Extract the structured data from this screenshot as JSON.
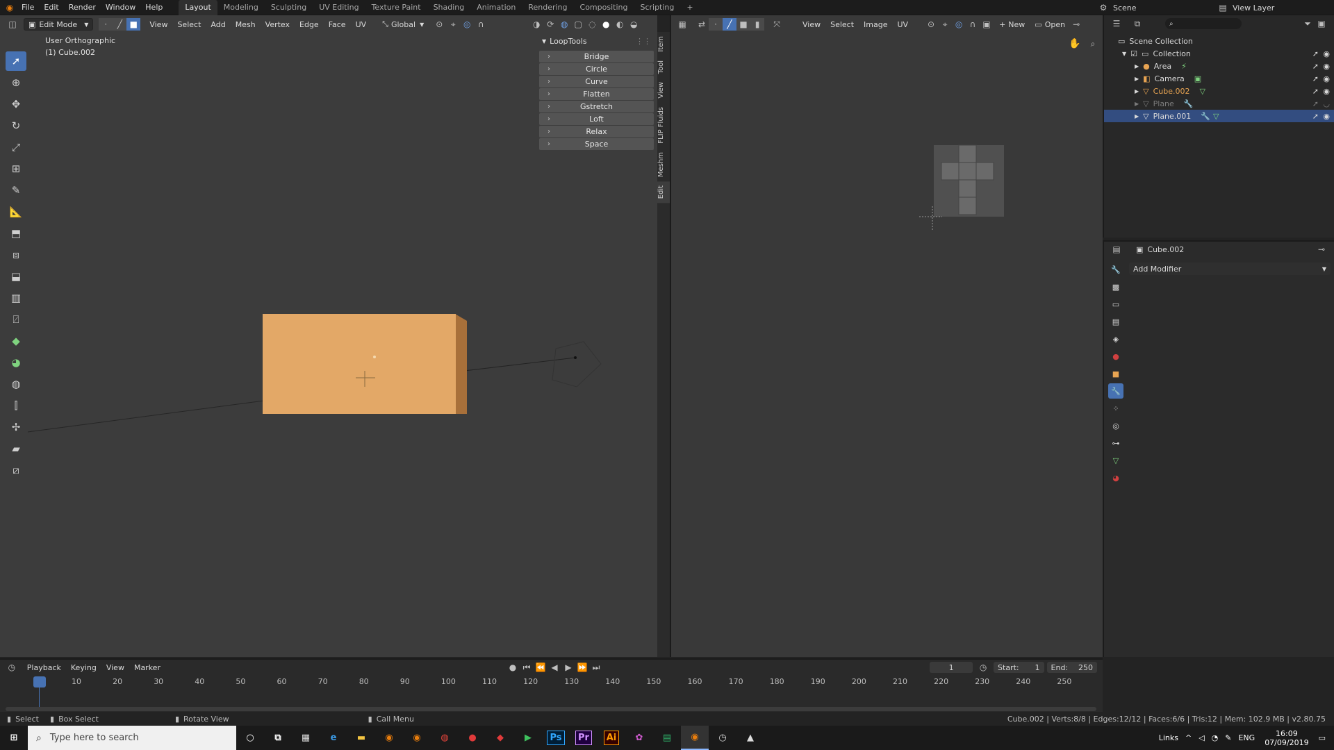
{
  "topbar": {
    "menus": [
      "File",
      "Edit",
      "Render",
      "Window",
      "Help"
    ],
    "workspaces": [
      "Layout",
      "Modeling",
      "Sculpting",
      "UV Editing",
      "Texture Paint",
      "Shading",
      "Animation",
      "Rendering",
      "Compositing",
      "Scripting"
    ],
    "active_workspace": "Layout",
    "scene_label": "Scene",
    "view_layer_label": "View Layer"
  },
  "viewport": {
    "mode": "Edit Mode",
    "menus": [
      "View",
      "Select",
      "Add",
      "Mesh",
      "Vertex",
      "Edge",
      "Face",
      "UV"
    ],
    "transform_orientation": "Global",
    "view_name": "User Orthographic",
    "object_name": "(1) Cube.002"
  },
  "looptools": {
    "title": "LoopTools",
    "items": [
      "Bridge",
      "Circle",
      "Curve",
      "Flatten",
      "Gstretch",
      "Loft",
      "Relax",
      "Space"
    ]
  },
  "sidebar_tabs": [
    "Item",
    "Tool",
    "View",
    "FLIP Fluids",
    "Meshm",
    "Edit"
  ],
  "uv_editor": {
    "menus": [
      "View",
      "Select",
      "Image",
      "UV"
    ],
    "new_label": "New",
    "open_label": "Open"
  },
  "outliner": {
    "root": "Scene Collection",
    "collection": "Collection",
    "items": [
      {
        "name": "Area",
        "color": "#d8d8d8"
      },
      {
        "name": "Camera",
        "color": "#d8d8d8"
      },
      {
        "name": "Cube.002",
        "color": "#e8a452"
      },
      {
        "name": "Plane",
        "color": "#7a7a7a"
      },
      {
        "name": "Plane.001",
        "color": "#ffffff"
      }
    ]
  },
  "properties": {
    "object_name": "Cube.002",
    "add_modifier_label": "Add Modifier"
  },
  "timeline": {
    "menus": [
      "Playback",
      "Keying",
      "View",
      "Marker"
    ],
    "current_frame": "1",
    "start_label": "Start:",
    "start_value": "1",
    "end_label": "End:",
    "end_value": "250",
    "ticks": [
      "1",
      "10",
      "20",
      "30",
      "40",
      "50",
      "60",
      "70",
      "80",
      "90",
      "100",
      "110",
      "120",
      "130",
      "140",
      "150",
      "160",
      "170",
      "180",
      "190",
      "200",
      "210",
      "220",
      "230",
      "240",
      "250"
    ]
  },
  "statusbar": {
    "select": "Select",
    "box_select": "Box Select",
    "rotate_view": "Rotate View",
    "call_menu": "Call Menu",
    "stats": "Cube.002 | Verts:8/8 | Edges:12/12 | Faces:6/6 | Tris:12 | Mem: 102.9 MB | v2.80.75"
  },
  "taskbar": {
    "search_placeholder": "Type here to search",
    "apps": [
      {
        "label": "Ps",
        "color": "#31a8ff",
        "bg": "#001e36"
      },
      {
        "label": "Pr",
        "color": "#d291ff",
        "bg": "#1f0040"
      },
      {
        "label": "Ai",
        "color": "#ff9a00",
        "bg": "#330000"
      }
    ],
    "links_label": "Links",
    "lang": "ENG",
    "time": "16:09",
    "date": "07/09/2019"
  },
  "colors": {
    "accent": "#4772b3",
    "cube_face": "#e3a867",
    "cube_side": "#a8703a"
  }
}
